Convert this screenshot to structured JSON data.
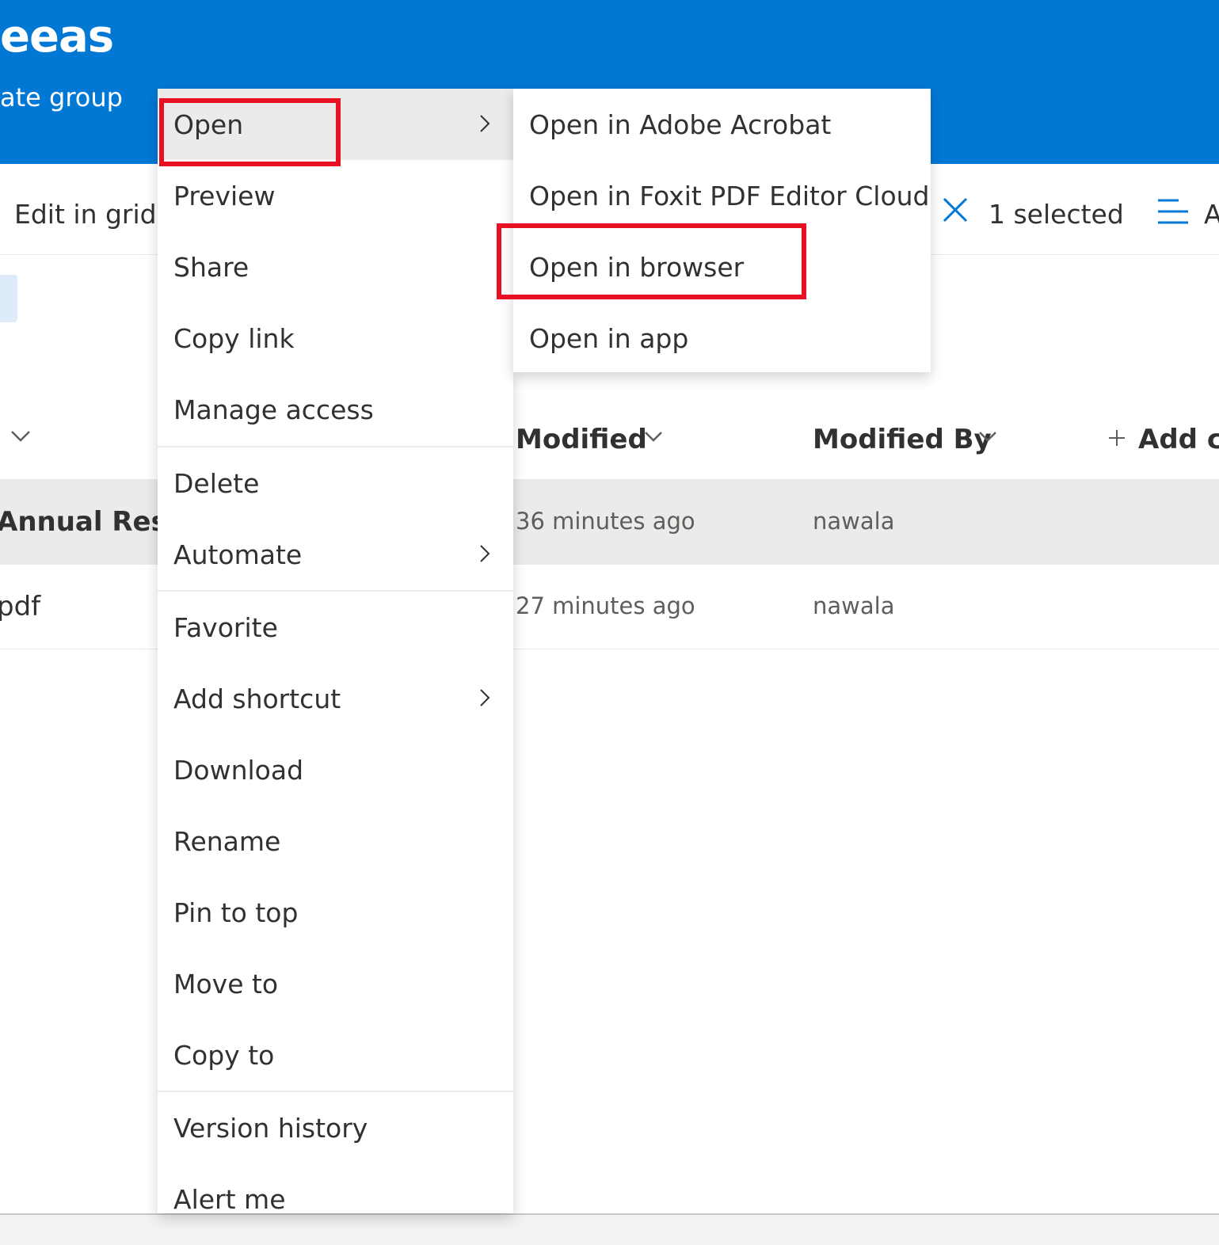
{
  "header": {
    "site_title": "eeas",
    "site_subtitle": "ate group",
    "background_color": "#0078d4"
  },
  "toolbar": {
    "edit_in_grid": "Edit in grid v",
    "selection_count": "1 selected",
    "trailing_text": "A",
    "icons": [
      "close-icon",
      "menu-lines-icon"
    ]
  },
  "columns": {
    "modified": "Modified",
    "modified_by": "Modified By",
    "add_column": "Add co"
  },
  "rows": [
    {
      "name": "Annual Result",
      "modified": "36 minutes ago",
      "modified_by": "nawala",
      "selected": true
    },
    {
      "name": "pdf",
      "modified": "27 minutes ago",
      "modified_by": "nawala",
      "selected": false
    }
  ],
  "context_menu": {
    "items": [
      {
        "label": "Open",
        "has_submenu": true
      },
      {
        "label": "Preview"
      },
      {
        "label": "Share"
      },
      {
        "label": "Copy link"
      },
      {
        "label": "Manage access"
      },
      {
        "label": "Delete"
      },
      {
        "label": "Automate",
        "has_submenu": true
      },
      {
        "label": "Favorite"
      },
      {
        "label": "Add shortcut",
        "has_submenu": true
      },
      {
        "label": "Download"
      },
      {
        "label": "Rename"
      },
      {
        "label": "Pin to top"
      },
      {
        "label": "Move to"
      },
      {
        "label": "Copy to"
      },
      {
        "label": "Version history"
      },
      {
        "label": "Alert me"
      }
    ]
  },
  "open_submenu": {
    "items": [
      {
        "label": "Open in Adobe Acrobat"
      },
      {
        "label": "Open in Foxit PDF Editor Cloud"
      },
      {
        "label": "Open in browser"
      },
      {
        "label": "Open in app"
      }
    ]
  },
  "annotation_color": "#e81123"
}
